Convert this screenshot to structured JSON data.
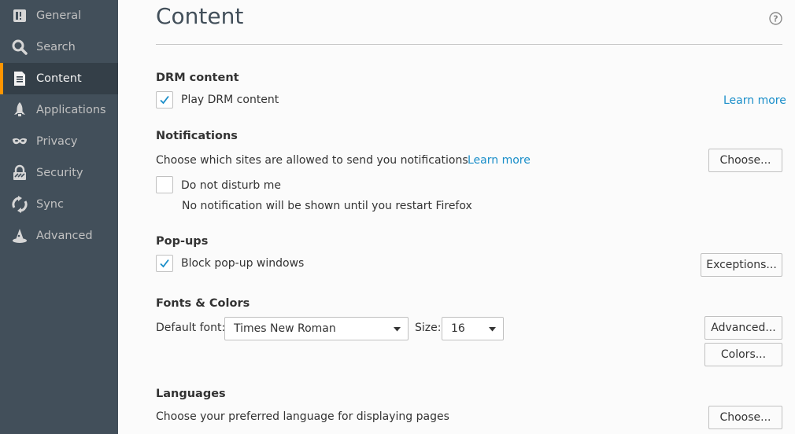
{
  "sidebar": {
    "items": [
      {
        "label": "General",
        "icon": "general-icon"
      },
      {
        "label": "Search",
        "icon": "search-icon"
      },
      {
        "label": "Content",
        "icon": "document-icon",
        "active": true
      },
      {
        "label": "Applications",
        "icon": "rocket-icon"
      },
      {
        "label": "Privacy",
        "icon": "mask-icon"
      },
      {
        "label": "Security",
        "icon": "lock-icon"
      },
      {
        "label": "Sync",
        "icon": "sync-icon"
      },
      {
        "label": "Advanced",
        "icon": "wizard-hat-icon"
      }
    ]
  },
  "page": {
    "title": "Content"
  },
  "drm": {
    "heading": "DRM content",
    "checkbox_label": "Play DRM content",
    "checked": true,
    "learn_more": "Learn more"
  },
  "notifications": {
    "heading": "Notifications",
    "description": "Choose which sites are allowed to send you notifications",
    "learn_more": "Learn more",
    "choose_button": "Choose...",
    "dnd_label": "Do not disturb me",
    "dnd_checked": false,
    "dnd_note": "No notification will be shown until you restart Firefox"
  },
  "popups": {
    "heading": "Pop-ups",
    "checkbox_label": "Block pop-up windows",
    "checked": true,
    "exceptions_button": "Exceptions..."
  },
  "fonts": {
    "heading": "Fonts & Colors",
    "default_font_label": "Default font:",
    "default_font_value": "Times New Roman",
    "size_label": "Size:",
    "size_value": "16",
    "advanced_button": "Advanced...",
    "colors_button": "Colors..."
  },
  "languages": {
    "heading": "Languages",
    "description": "Choose your preferred language for displaying pages",
    "choose_button": "Choose..."
  },
  "colors": {
    "sidebar_bg": "#424f5a",
    "sidebar_active_bg": "#343f48",
    "accent": "#ff9500",
    "link": "#1a8ec9",
    "check": "#1a8ec9"
  }
}
